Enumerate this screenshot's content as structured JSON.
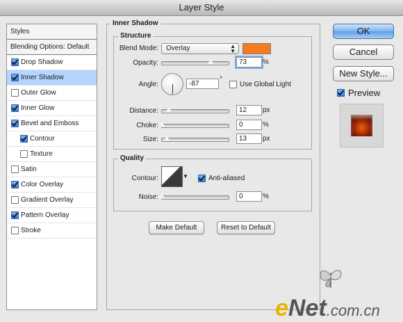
{
  "window": {
    "title": "Layer Style"
  },
  "styles_panel": {
    "header": "Styles",
    "blending": "Blending Options: Default",
    "items": [
      {
        "label": "Drop Shadow",
        "checked": true,
        "sub": false,
        "selected": false
      },
      {
        "label": "Inner Shadow",
        "checked": true,
        "sub": false,
        "selected": true
      },
      {
        "label": "Outer Glow",
        "checked": false,
        "sub": false,
        "selected": false
      },
      {
        "label": "Inner Glow",
        "checked": true,
        "sub": false,
        "selected": false
      },
      {
        "label": "Bevel and Emboss",
        "checked": true,
        "sub": false,
        "selected": false
      },
      {
        "label": "Contour",
        "checked": true,
        "sub": true,
        "selected": false
      },
      {
        "label": "Texture",
        "checked": false,
        "sub": true,
        "selected": false
      },
      {
        "label": "Satin",
        "checked": false,
        "sub": false,
        "selected": false
      },
      {
        "label": "Color Overlay",
        "checked": true,
        "sub": false,
        "selected": false
      },
      {
        "label": "Gradient Overlay",
        "checked": false,
        "sub": false,
        "selected": false
      },
      {
        "label": "Pattern Overlay",
        "checked": true,
        "sub": false,
        "selected": false
      },
      {
        "label": "Stroke",
        "checked": false,
        "sub": false,
        "selected": false
      }
    ]
  },
  "inner_shadow": {
    "title": "Inner Shadow",
    "structure": {
      "title": "Structure",
      "blend_mode_label": "Blend Mode:",
      "blend_mode_value": "Overlay",
      "color": "#f47c20",
      "opacity_label": "Opacity:",
      "opacity_value": "73",
      "opacity_level": 0.73,
      "opacity_unit": "%",
      "angle_label": "Angle:",
      "angle_value": "-87",
      "angle_unit": "°",
      "global_light_label": "Use Global Light",
      "global_light_checked": false,
      "distance_label": "Distance:",
      "distance_value": "12",
      "distance_unit": "px",
      "choke_label": "Choke:",
      "choke_value": "0",
      "choke_unit": "%",
      "size_label": "Size:",
      "size_value": "13",
      "size_unit": "px"
    },
    "quality": {
      "title": "Quality",
      "contour_label": "Contour:",
      "anti_aliased_label": "Anti-aliased",
      "anti_aliased_checked": true,
      "noise_label": "Noise:",
      "noise_value": "0",
      "noise_unit": "%"
    },
    "make_default": "Make Default",
    "reset_default": "Reset to Default"
  },
  "buttons": {
    "ok": "OK",
    "cancel": "Cancel",
    "new_style": "New Style..."
  },
  "preview": {
    "label": "Preview",
    "checked": true
  },
  "watermark": {
    "e": "e",
    "net": "Net",
    "rest": ".com.cn"
  }
}
